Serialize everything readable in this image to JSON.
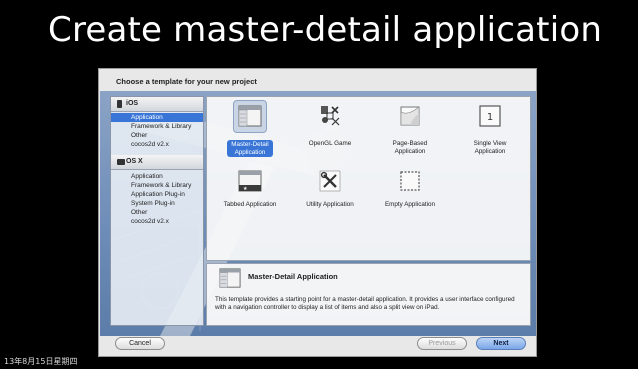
{
  "slide": {
    "title": "Create master-detail application",
    "date": "13年8月15日星期四"
  },
  "dialog": {
    "header": "Choose a template for your new project",
    "sidebar": {
      "sections": [
        {
          "label": "iOS",
          "items": [
            "Application",
            "Framework & Library",
            "Other",
            "cocos2d v2.x"
          ],
          "selected_index": 0
        },
        {
          "label": "OS X",
          "items": [
            "Application",
            "Framework & Library",
            "Application Plug-in",
            "System Plug-in",
            "Other",
            "cocos2d v2.x"
          ]
        }
      ]
    },
    "templates": [
      {
        "label": "Master-Detail\nApplication",
        "icon": "master-detail-icon",
        "selected": true
      },
      {
        "label": "OpenGL Game",
        "icon": "opengl-game-icon"
      },
      {
        "label": "Page-Based\nApplication",
        "icon": "page-based-icon"
      },
      {
        "label": "Single View\nApplication",
        "icon": "single-view-icon"
      },
      {
        "label": "Tabbed Application",
        "icon": "tabbed-icon"
      },
      {
        "label": "Utility Application",
        "icon": "utility-icon"
      },
      {
        "label": "Empty Application",
        "icon": "empty-icon"
      }
    ],
    "description": {
      "title": "Master-Detail Application",
      "text": "This template provides a starting point for a master-detail application. It provides a user interface configured with a navigation controller to display a list of items and also a split view on iPad."
    },
    "buttons": {
      "cancel": "Cancel",
      "previous": "Previous",
      "next": "Next"
    },
    "colors": {
      "selection": "#3875d7",
      "backdrop": "#7090bb"
    }
  }
}
